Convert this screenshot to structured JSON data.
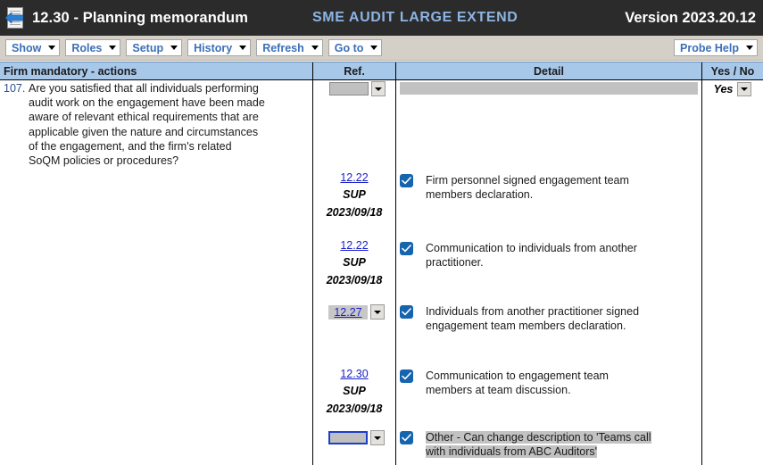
{
  "titlebar": {
    "icon": "back-document-icon",
    "title": "12.30 - Planning memorandum",
    "engagement": "SME  AUDIT  LARGE  EXTEND",
    "version": "Version 2023.20.12",
    "bg_color": "#2b2b2b",
    "engagement_color": "#8db4e2"
  },
  "toolbar": {
    "buttons": [
      {
        "label": "Show"
      },
      {
        "label": "Roles"
      },
      {
        "label": "Setup"
      },
      {
        "label": "History"
      },
      {
        "label": "Refresh"
      },
      {
        "label": "Go to"
      }
    ],
    "help_button": {
      "label": "Probe Help"
    },
    "label_color": "#3b6fb6",
    "bg_color": "#d4d0c8"
  },
  "grid": {
    "headers": {
      "actions": "Firm mandatory - actions",
      "ref": "Ref.",
      "detail": "Detail",
      "yesno": "Yes / No"
    },
    "header_bg": "#a8c8ea",
    "question": {
      "number": "107.",
      "text": "Are you satisfied that all individuals performing\naudit work on the engagement have been made\naware of relevant ethical requirements that are\napplicable given the nature and circumstances\nof the engagement, and the firm's related\nSoQM policies or procedures?"
    },
    "yesno_value": "Yes",
    "ref_entries": [
      {
        "link": "12.22",
        "sup": "SUP",
        "date": "2023/09/18"
      },
      {
        "link": "12.22",
        "sup": "SUP",
        "date": "2023/09/18"
      },
      {
        "combo_value": "12.27",
        "selected": true
      },
      {
        "link": "12.30",
        "sup": "SUP",
        "date": "2023/09/18"
      },
      {
        "combo_value": "",
        "focused": true
      }
    ],
    "detail_rows": [
      {
        "checked": true,
        "text": "Firm personnel signed engagement team\nmembers declaration.",
        "highlighted": false
      },
      {
        "checked": true,
        "text": "Communication to individuals from another\npractitioner.",
        "highlighted": false
      },
      {
        "checked": true,
        "text": "Individuals from another practitioner signed\nengagement team members declaration.",
        "highlighted": false
      },
      {
        "checked": true,
        "text": "Communication to engagement team\nmembers at team discussion.",
        "highlighted": false
      },
      {
        "checked": true,
        "text": "Other - Can change description to 'Teams call\nwith individuals from ABC Auditors'",
        "highlighted": true
      }
    ],
    "checkbox_color": "#1464ae",
    "link_color": "#1b22c8",
    "highlight_color": "#c2c2c2"
  }
}
